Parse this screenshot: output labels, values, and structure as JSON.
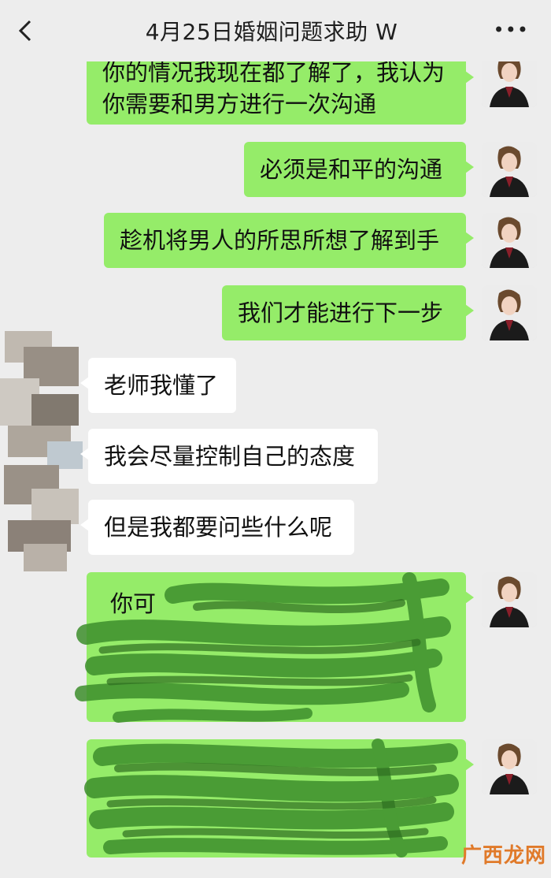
{
  "header": {
    "title": "4月25日婚姻问题求助 W",
    "back_icon": "chevron-left-icon",
    "more_icon": "more-dots-icon",
    "more_text": "•••"
  },
  "messages": [
    {
      "side": "right",
      "lines": [
        "你的情况我现在都了解了，我认为",
        "你需要和男方进行一次沟通"
      ]
    },
    {
      "side": "right",
      "text": "必须是和平的沟通"
    },
    {
      "side": "right",
      "text": "趁机将男人的所思所想了解到手"
    },
    {
      "side": "right",
      "text": "我们才能进行下一步"
    },
    {
      "side": "left",
      "text": "老师我懂了"
    },
    {
      "side": "left",
      "text": "我会尽量控制自己的态度"
    },
    {
      "side": "left",
      "text": "但是我都要问些什么呢"
    },
    {
      "side": "right",
      "text": "你可",
      "redacted": true
    },
    {
      "side": "right",
      "text": "",
      "redacted": true
    }
  ],
  "watermark": "广西龙网",
  "colors": {
    "background": "#ededed",
    "sent_bubble": "#95ec69",
    "received_bubble": "#ffffff",
    "scribble": "#3e8f2c",
    "watermark": "#e07a2a"
  }
}
